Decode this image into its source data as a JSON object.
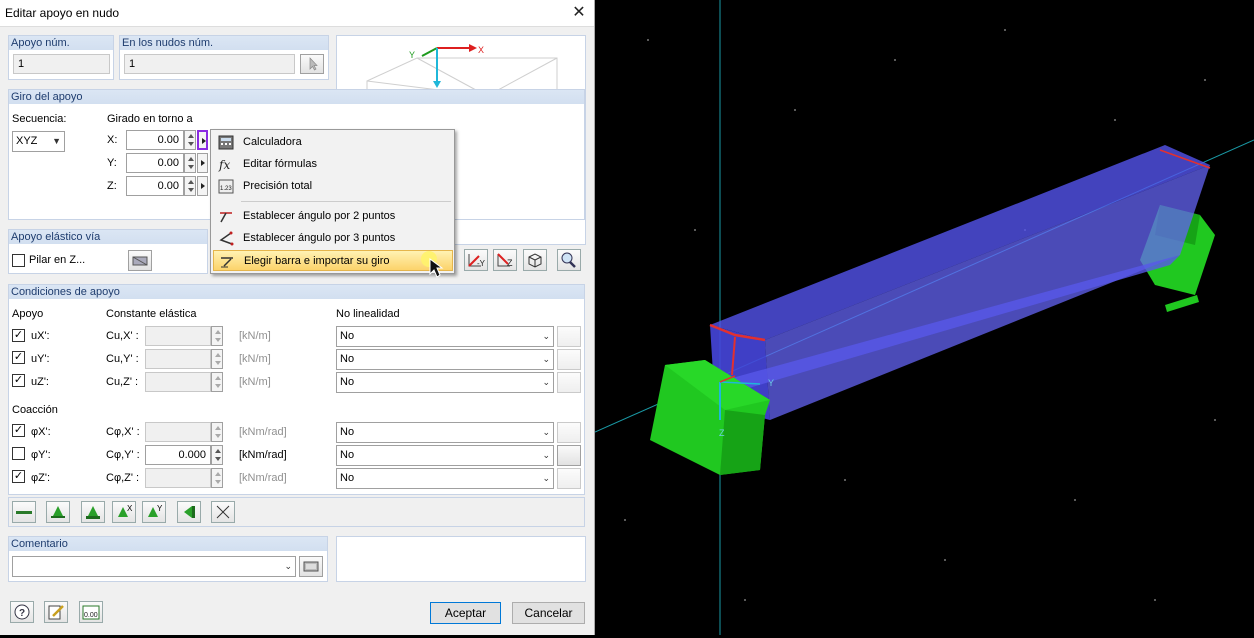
{
  "window": {
    "title": "Editar apoyo en nudo",
    "close_glyph": "✕"
  },
  "support_no": {
    "header": "Apoyo núm.",
    "value": "1"
  },
  "at_nodes": {
    "header": "En los nudos núm.",
    "value": "1"
  },
  "rotation": {
    "header": "Giro del apoyo",
    "sequence_label": "Secuencia:",
    "sequence_value": "XYZ",
    "rotated_about_label": "Girado en torno a",
    "axes": [
      {
        "label": "X:",
        "value": "0.00"
      },
      {
        "label": "Y:",
        "value": "0.00"
      },
      {
        "label": "Z:",
        "value": "0.00"
      }
    ]
  },
  "context_menu": {
    "items": [
      {
        "label": "Calculadora",
        "icon": "calculator-icon"
      },
      {
        "label": "Editar fórmulas",
        "icon": "formula-icon"
      },
      {
        "label": "Precisión total",
        "icon": "precision-icon"
      },
      {
        "label": "Establecer ángulo por 2 puntos",
        "icon": "angle-2-points-icon"
      },
      {
        "label": "Establecer ángulo por 3 puntos",
        "icon": "angle-3-points-icon"
      },
      {
        "label": "Elegir barra e importar su giro",
        "icon": "pick-member-icon",
        "highlighted": true
      }
    ]
  },
  "elastic": {
    "header": "Apoyo elástico vía",
    "column_label": "Pilar en Z..."
  },
  "conditions": {
    "header": "Condiciones de apoyo",
    "col_support": "Apoyo",
    "col_constant": "Constante elástica",
    "col_nonlinear": "No linealidad",
    "translational": [
      {
        "label": "uX':",
        "constant_label": "Cu,X' :",
        "value": "",
        "unit": "[kN/m]",
        "checked": true,
        "nonlinear": "No"
      },
      {
        "label": "uY':",
        "constant_label": "Cu,Y' :",
        "value": "",
        "unit": "[kN/m]",
        "checked": true,
        "nonlinear": "No"
      },
      {
        "label": "uZ':",
        "constant_label": "Cu,Z' :",
        "value": "",
        "unit": "[kN/m]",
        "checked": true,
        "nonlinear": "No"
      }
    ],
    "restraint_header": "Coacción",
    "rotational": [
      {
        "label": "φX':",
        "constant_label": "Cφ,X' :",
        "value": "",
        "unit": "[kNm/rad]",
        "checked": true,
        "nonlinear": "No"
      },
      {
        "label": "φY':",
        "constant_label": "Cφ,Y' :",
        "value": "0.000",
        "unit": "[kNm/rad]",
        "checked": false,
        "nonlinear": "No"
      },
      {
        "label": "φZ':",
        "constant_label": "Cφ,Z' :",
        "value": "",
        "unit": "[kNm/rad]",
        "checked": true,
        "nonlinear": "No"
      }
    ]
  },
  "comment": {
    "header": "Comentario",
    "value": ""
  },
  "buttons": {
    "ok": "Aceptar",
    "cancel": "Cancelar"
  },
  "preview_axes": {
    "x": "X",
    "y": "Y",
    "z": "Z",
    "x_local": "X'"
  },
  "scene_axes": {
    "y": "Y",
    "z": "Z"
  },
  "colors": {
    "header_bg": "#d6e2f2",
    "support_green": "#22dd22",
    "beam_blue": "#5b5bf0",
    "highlight": "#fcd36b"
  }
}
